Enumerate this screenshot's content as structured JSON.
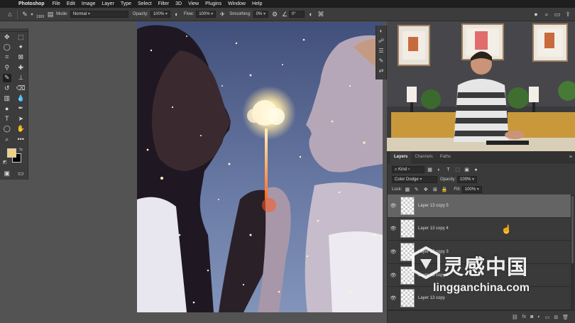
{
  "menubar": {
    "app_name": "Photoshop",
    "items": [
      "File",
      "Edit",
      "Image",
      "Layer",
      "Type",
      "Select",
      "Filter",
      "3D",
      "View",
      "Plugins",
      "Window",
      "Help"
    ]
  },
  "options_bar": {
    "brush_size": "1309",
    "mode_label": "Mode:",
    "mode_value": "Normal",
    "opacity_label": "Opacity:",
    "opacity_value": "100%",
    "flow_label": "Flow:",
    "flow_value": "100%",
    "smoothing_label": "Smoothing:",
    "smoothing_value": "0%",
    "angle_value": "0°"
  },
  "layers_panel": {
    "tabs": [
      "Layers",
      "Channels",
      "Paths"
    ],
    "filter_kind": "Kind",
    "blend_mode": "Color Dodge",
    "opacity_label": "Opacity:",
    "opacity_value": "100%",
    "lock_label": "Lock:",
    "fill_label": "Fill:",
    "fill_value": "100%",
    "layers": [
      {
        "name": "Layer 13 copy 5",
        "selected": true
      },
      {
        "name": "Layer 13 copy 4",
        "selected": false
      },
      {
        "name": "Layer 13 copy 3",
        "selected": false
      },
      {
        "name": "Layer 13 copy 2",
        "selected": false
      },
      {
        "name": "Layer 13 copy",
        "selected": false
      }
    ]
  },
  "watermark": {
    "title": "灵感中国",
    "url": "lingganchina.com"
  },
  "colors": {
    "foreground": "#f0d080",
    "background": "#000000"
  }
}
